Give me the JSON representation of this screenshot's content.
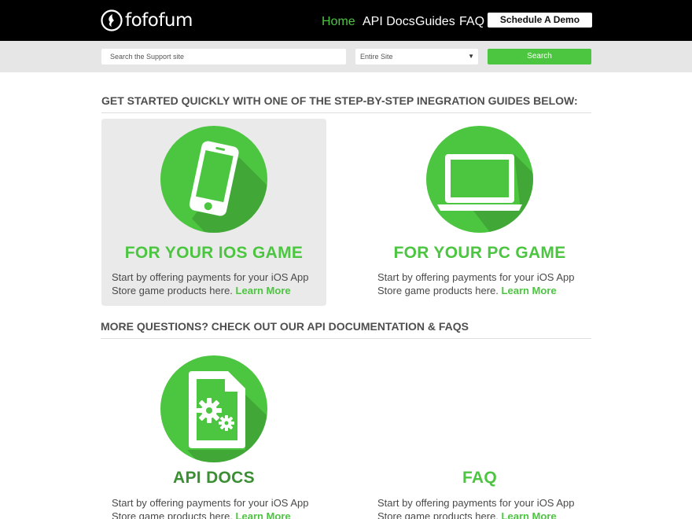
{
  "header": {
    "logo_text": "fofofum",
    "nav": [
      {
        "label": "Home",
        "active": true
      },
      {
        "label": "API Docs",
        "active": false
      },
      {
        "label": "Guides",
        "active": false
      },
      {
        "label": "FAQ",
        "active": false
      }
    ],
    "demo_button": "Schedule A Demo"
  },
  "search": {
    "placeholder": "Search the Support site",
    "scope_selected": "Entire Site",
    "button_label": "Search"
  },
  "sections": {
    "guides_heading": "GET STARTED QUICKLY WITH ONE OF THE STEP-BY-STEP INEGRATION GUIDES BELOW:",
    "docs_heading": "MORE QUESTIONS? CHECK OUT OUR API DOCUMENTATION & FAQS"
  },
  "cards": [
    {
      "title": "FOR YOUR IOS GAME",
      "desc": "Start by offering payments for your iOS App Store game products here.",
      "link": "Learn More",
      "icon": "smartphone-icon"
    },
    {
      "title": "FOR YOUR PC GAME",
      "desc": "Start by offering payments for your iOS App Store game products here.",
      "link": "Learn More",
      "icon": "laptop-icon"
    },
    {
      "title": "API DOCS",
      "desc": "Start by offering payments for your iOS App Store game products here.",
      "link": "Learn More",
      "icon": "document-gears-icon"
    },
    {
      "title": "FAQ",
      "desc": "Start by offering payments for your iOS App Store game products here.",
      "link": "Learn More",
      "icon": "faq-icon"
    }
  ],
  "colors": {
    "brand_green": "#4cc540",
    "dark_green": "#3a8f33",
    "header_bg": "#000000",
    "searchbar_bg": "#e6e6e6",
    "card_highlight": "#eaeaea"
  }
}
